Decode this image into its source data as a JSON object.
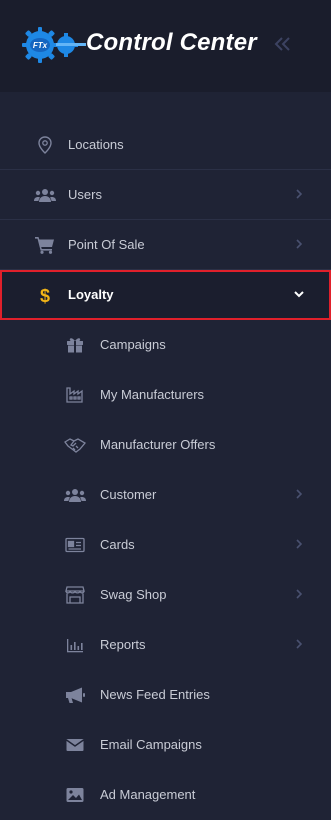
{
  "brand": {
    "title": "Control Center",
    "logo_text": "FTx"
  },
  "nav": {
    "items": [
      {
        "label": "Locations",
        "icon": "map-pin-icon",
        "chevron": false
      },
      {
        "label": "Users",
        "icon": "users-icon",
        "chevron": true
      },
      {
        "label": "Point Of Sale",
        "icon": "cart-icon",
        "chevron": true
      },
      {
        "label": "Loyalty",
        "icon": "dollar-icon",
        "chevron": true,
        "active": true,
        "expanded": true
      }
    ],
    "subitems": [
      {
        "label": "Campaigns",
        "icon": "gift-icon",
        "chevron": false
      },
      {
        "label": "My Manufacturers",
        "icon": "factory-icon",
        "chevron": false
      },
      {
        "label": "Manufacturer Offers",
        "icon": "handshake-icon",
        "chevron": false
      },
      {
        "label": "Customer",
        "icon": "users-icon",
        "chevron": true
      },
      {
        "label": "Cards",
        "icon": "id-card-icon",
        "chevron": true
      },
      {
        "label": "Swag Shop",
        "icon": "store-icon",
        "chevron": true
      },
      {
        "label": "Reports",
        "icon": "bar-chart-icon",
        "chevron": true
      },
      {
        "label": "News Feed Entries",
        "icon": "megaphone-icon",
        "chevron": false
      },
      {
        "label": "Email Campaigns",
        "icon": "envelope-icon",
        "chevron": false
      },
      {
        "label": "Ad Management",
        "icon": "image-icon",
        "chevron": false
      }
    ]
  },
  "colors": {
    "background": "#1f2335",
    "header": "#1a1d2c",
    "active_border": "#e0202b",
    "accent_blue": "#1e88e5",
    "accent_gold": "#f2b417"
  }
}
